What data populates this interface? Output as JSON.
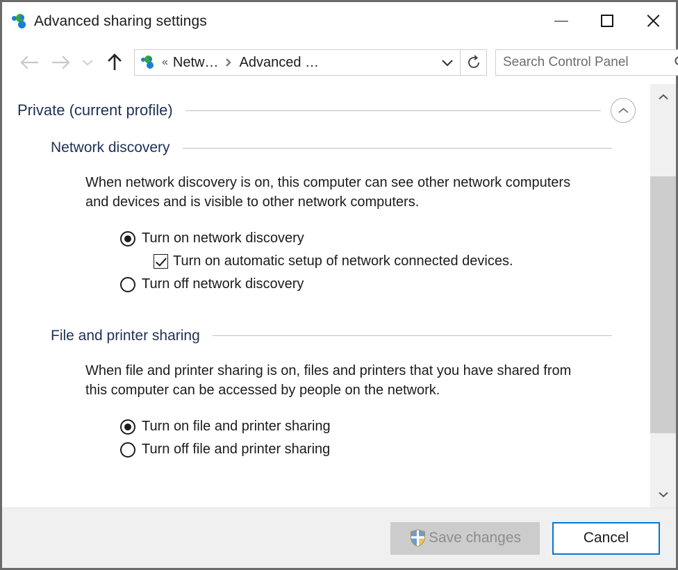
{
  "window": {
    "title": "Advanced sharing settings",
    "icon": "network-sharing-icon",
    "minimize_label": "Minimize",
    "maximize_label": "Maximize",
    "close_label": "Close"
  },
  "navbar": {
    "back_label": "Back",
    "forward_label": "Forward",
    "recent_label": "Recent locations",
    "up_label": "Up",
    "breadcrumb": {
      "overflow": "«",
      "items": [
        "Netw…",
        "Advanced …"
      ],
      "separator": "›"
    },
    "dropdown_label": "Previous locations",
    "refresh_label": "Refresh",
    "search": {
      "placeholder": "Search Control Panel",
      "value": ""
    }
  },
  "content": {
    "profile": {
      "heading": "Private (current profile)",
      "collapse_label": "Collapse"
    },
    "sections": [
      {
        "heading": "Network discovery",
        "description": "When network discovery is on, this computer can see other network computers and devices and is visible to other network computers.",
        "options": [
          {
            "type": "radio",
            "label": "Turn on network discovery",
            "checked": true,
            "indented": false
          },
          {
            "type": "checkbox",
            "label": "Turn on automatic setup of network connected devices.",
            "checked": true,
            "indented": true
          },
          {
            "type": "radio",
            "label": "Turn off network discovery",
            "checked": false,
            "indented": false
          }
        ]
      },
      {
        "heading": "File and printer sharing",
        "description": "When file and printer sharing is on, files and printers that you have shared from this computer can be accessed by people on the network.",
        "options": [
          {
            "type": "radio",
            "label": "Turn on file and printer sharing",
            "checked": true,
            "indented": false
          },
          {
            "type": "radio",
            "label": "Turn off file and printer sharing",
            "checked": false,
            "indented": false
          }
        ]
      }
    ]
  },
  "scrollbar": {
    "up_label": "Scroll up",
    "down_label": "Scroll down"
  },
  "footer": {
    "save_label": "Save changes",
    "save_disabled": true,
    "save_icon": "uac-shield-icon",
    "cancel_label": "Cancel"
  },
  "colors": {
    "accent": "#0078d7",
    "heading": "#1d3152",
    "text": "#1b1b1b",
    "disabled_text": "#8d8d8d",
    "button_disabled_bg": "#cccccc",
    "footer_bg": "#f0f0f0",
    "window_border": "#6b6b6b",
    "rule": "#bfbfbf",
    "scroll_thumb": "#cdcdcd"
  }
}
